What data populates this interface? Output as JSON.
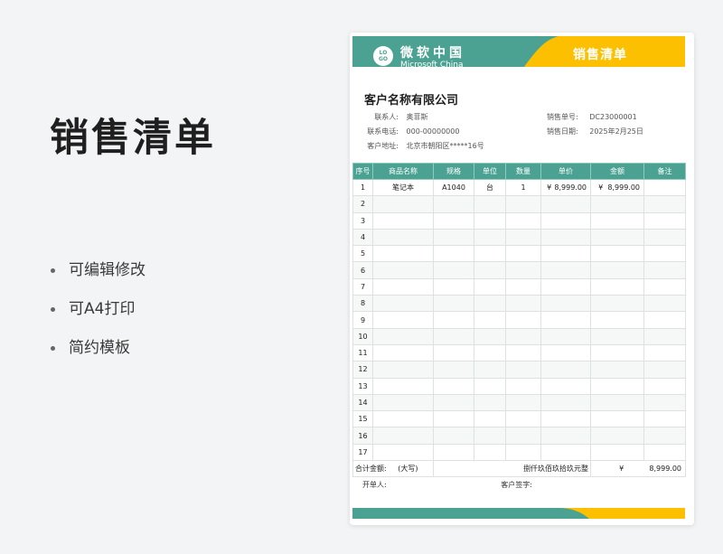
{
  "promo": {
    "title": "销售清单",
    "features": [
      "可编辑修改",
      "可A4打印",
      "简约模板"
    ]
  },
  "colors": {
    "primary": "#4ca292",
    "accent": "#fcc000"
  },
  "header": {
    "logo_text_1": "LO",
    "logo_text_2": "GO",
    "company_cn": "微软中国",
    "company_en": "Microsoft China",
    "doc_title": "销售清单"
  },
  "customer": {
    "name": "客户名称有限公司",
    "contact_label": "联系人:",
    "contact": "奥菲斯",
    "phone_label": "联系电话:",
    "phone": "000-00000000",
    "address_label": "客户地址:",
    "address": "北京市朝阳区*****16号",
    "order_no_label": "销售单号:",
    "order_no": "DC23000001",
    "date_label": "销售日期:",
    "date": "2025年2月25日"
  },
  "table": {
    "headers": [
      "序号",
      "商品名称",
      "规格",
      "单位",
      "数量",
      "单价",
      "金额",
      "备注"
    ],
    "rows": [
      {
        "no": "1",
        "name": "笔记本",
        "spec": "A1040",
        "unit": "台",
        "qty": "1",
        "price_sym": "¥",
        "price": "8,999.00",
        "amount_sym": "¥",
        "amount": "8,999.00",
        "note": ""
      },
      {
        "no": "2"
      },
      {
        "no": "3"
      },
      {
        "no": "4"
      },
      {
        "no": "5"
      },
      {
        "no": "6"
      },
      {
        "no": "7"
      },
      {
        "no": "8"
      },
      {
        "no": "9"
      },
      {
        "no": "10"
      },
      {
        "no": "11"
      },
      {
        "no": "12"
      },
      {
        "no": "13"
      },
      {
        "no": "14"
      },
      {
        "no": "15"
      },
      {
        "no": "16"
      },
      {
        "no": "17"
      }
    ],
    "total_label": "合计金额:",
    "total_upper_label": "(大写)",
    "total_upper": "捌仟玖佰玖拾玖元整",
    "total_sym": "¥",
    "total": "8,999.00"
  },
  "signatures": {
    "issuer_label": "开单人:",
    "customer_sign_label": "客户签字:"
  }
}
